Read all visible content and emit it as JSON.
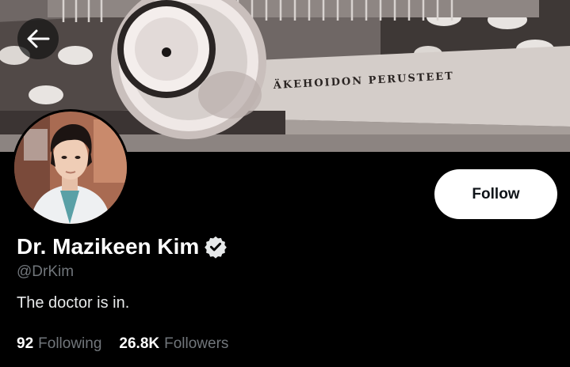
{
  "banner": {
    "book_text": "ÄKEHOIDON PERUSTEET"
  },
  "profile": {
    "display_name": "Dr. Mazikeen Kim",
    "verified_icon": "verified-badge-icon",
    "handle": "@DrKim",
    "bio": "The doctor is in."
  },
  "actions": {
    "follow_label": "Follow",
    "back_icon": "arrow-left-icon"
  },
  "stats": [
    {
      "count": "92",
      "label": "Following"
    },
    {
      "count": "26.8K",
      "label": "Followers"
    }
  ],
  "colors": {
    "background": "#000000",
    "primary_text": "#ffffff",
    "secondary_text": "#71767b",
    "follow_button_bg": "#ffffff"
  }
}
